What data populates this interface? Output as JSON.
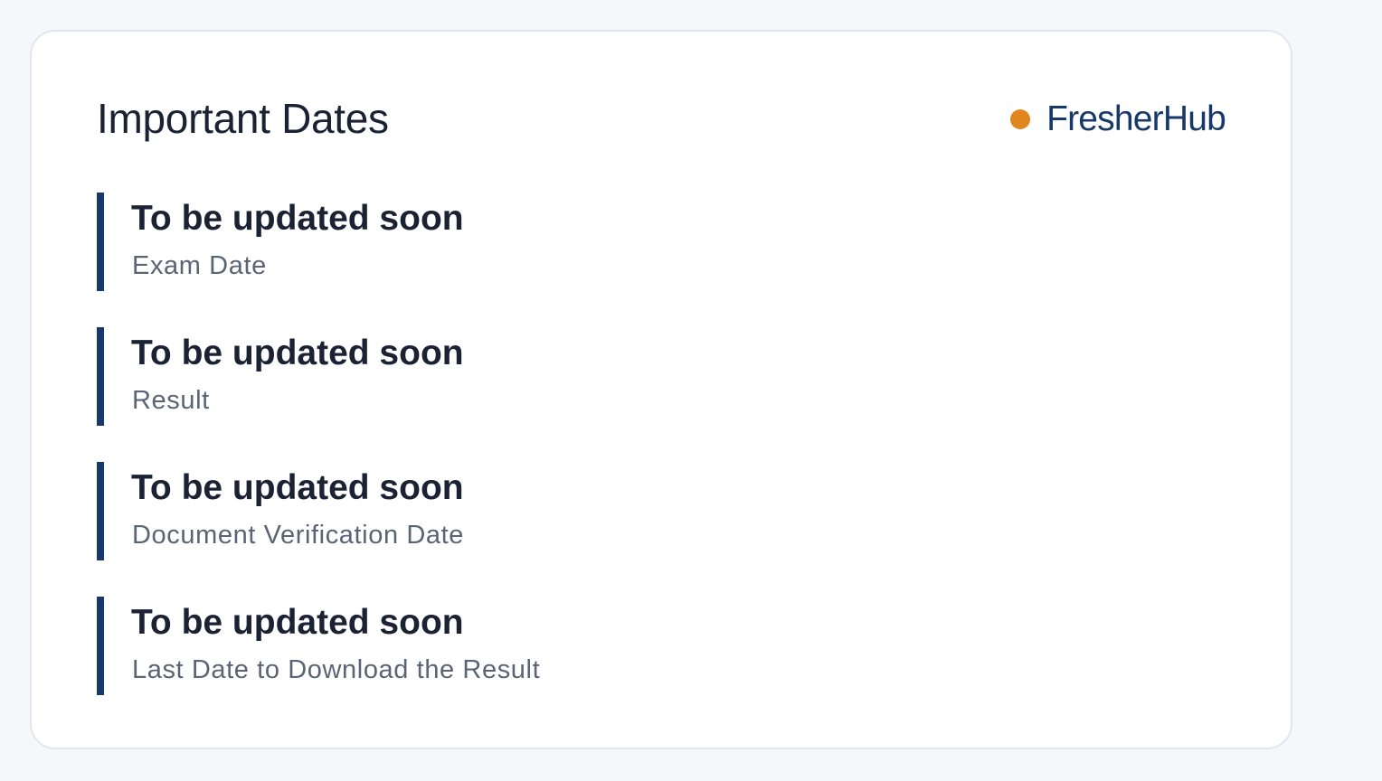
{
  "card": {
    "title": "Important Dates",
    "brand": {
      "name": "FresherHub",
      "dot_color": "#e0861c",
      "text_color": "#17386a"
    },
    "accent_color": "#17386a",
    "items": [
      {
        "value": "To be updated soon",
        "label": "Exam Date"
      },
      {
        "value": "To be updated soon",
        "label": "Result"
      },
      {
        "value": "To be updated soon",
        "label": "Document Verification Date"
      },
      {
        "value": "To be updated soon",
        "label": "Last Date to Download the Result"
      }
    ]
  }
}
